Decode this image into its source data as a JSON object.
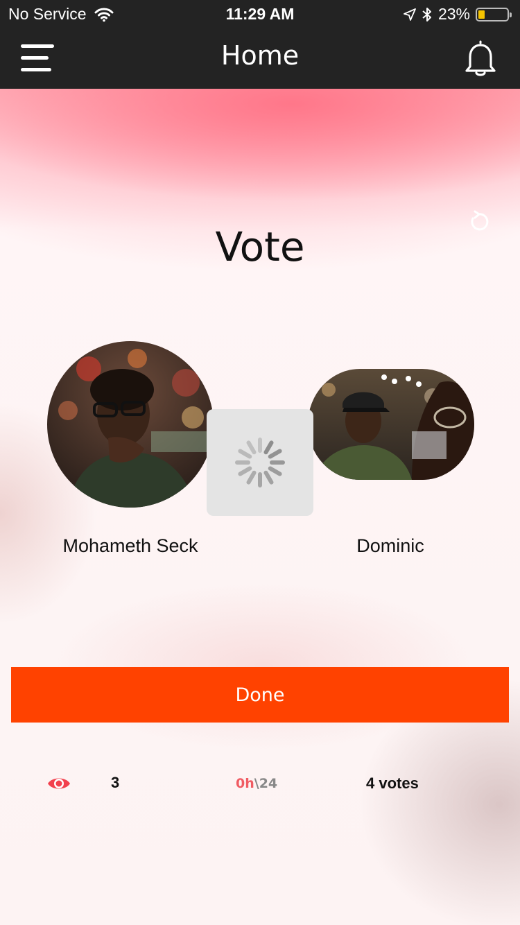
{
  "status_bar": {
    "carrier": "No Service",
    "time": "11:29 AM",
    "battery_percent": "23%",
    "battery_level": 0.23,
    "icons": [
      "wifi-icon",
      "location-icon",
      "bluetooth-icon",
      "battery-icon"
    ]
  },
  "nav": {
    "title": "Home",
    "menu_icon": "hamburger-menu-icon",
    "notification_icon": "bell-icon"
  },
  "main": {
    "heading": "Vote",
    "refresh_icon": "refresh-icon",
    "candidates": [
      {
        "name": "Mohameth Seck"
      },
      {
        "name": "Dominic"
      }
    ],
    "loading_icon": "spinner-icon",
    "done_label": "Done"
  },
  "stats": {
    "views_icon": "eye-icon",
    "views": "3",
    "timer_hours": "0h",
    "timer_separator": "\\",
    "timer_minutes": "24",
    "votes": "4 votes"
  },
  "colors": {
    "bar_background": "#232323",
    "accent": "#ff4200",
    "eye": "#f2404d",
    "timer_hours": "#f05c63"
  }
}
